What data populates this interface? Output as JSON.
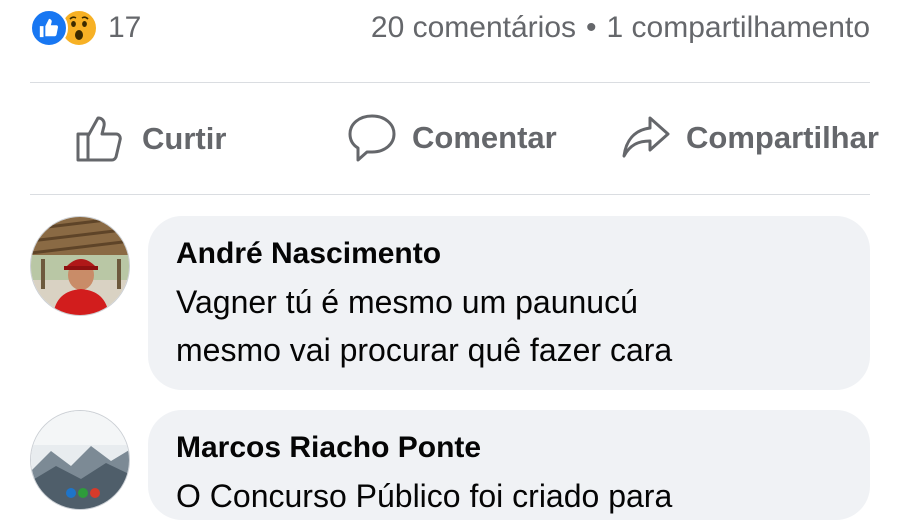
{
  "reactions": {
    "icons": [
      "like-icon",
      "wow-icon"
    ],
    "count": "17",
    "colors": {
      "like": "#1877f2",
      "wow": "#f7b125"
    }
  },
  "summary": {
    "comments": "20 comentários",
    "separator": "•",
    "shares": "1 compartilhamento"
  },
  "actions": {
    "like": {
      "label": "Curtir",
      "icon": "thumbs-up-icon"
    },
    "comment": {
      "label": "Comentar",
      "icon": "speech-bubble-icon"
    },
    "share": {
      "label": "Compartilhar",
      "icon": "share-arrow-icon"
    }
  },
  "comments": [
    {
      "author": "André Nascimento",
      "text_line1": "Vagner tú é mesmo um paunucú",
      "text_line2": "mesmo vai procurar quê fazer cara"
    },
    {
      "author": "Marcos Riacho Ponte",
      "text_line1": "O Concurso Público foi criado para"
    }
  ],
  "colors": {
    "muted_text": "#65676b",
    "bubble": "#f0f2f5",
    "divider": "#dadde1"
  }
}
